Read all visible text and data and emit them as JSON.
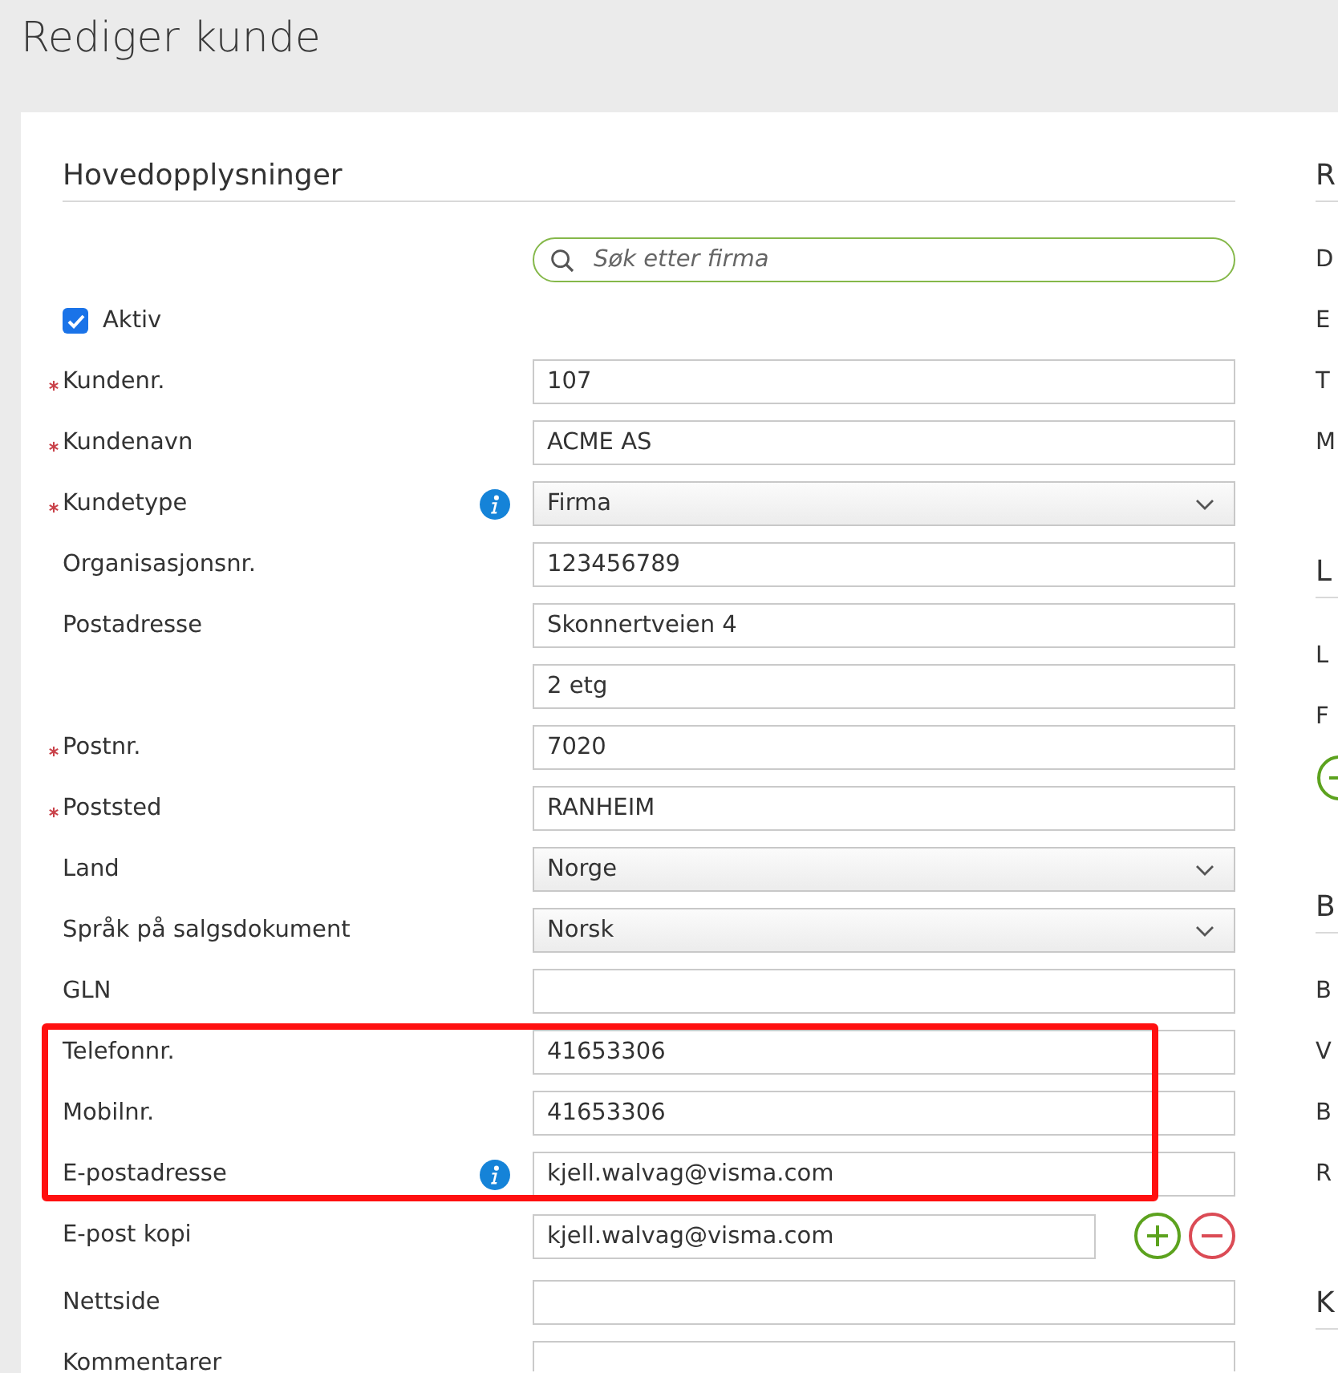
{
  "page": {
    "title": "Rediger kunde"
  },
  "main_section": {
    "heading": "Hovedopplysninger",
    "search": {
      "placeholder": "Søk etter firma"
    },
    "rows": [
      {
        "kind": "checkbox",
        "label": "Aktiv",
        "checked": true,
        "required": false,
        "info": false,
        "highlighted": false
      },
      {
        "kind": "text",
        "label": "Kundenr.",
        "value": "107",
        "required": true,
        "info": false,
        "highlighted": false
      },
      {
        "kind": "text",
        "label": "Kundenavn",
        "value": "ACME AS",
        "required": true,
        "info": false,
        "highlighted": false
      },
      {
        "kind": "select",
        "label": "Kundetype",
        "value": "Firma",
        "required": true,
        "info": true,
        "highlighted": false
      },
      {
        "kind": "text",
        "label": "Organisasjonsnr.",
        "value": "123456789",
        "required": false,
        "info": false,
        "highlighted": false
      },
      {
        "kind": "text",
        "label": "Postadresse",
        "value": "Skonnertveien 4",
        "required": false,
        "info": false,
        "highlighted": false
      },
      {
        "kind": "text",
        "value": "2 etg",
        "required": false,
        "info": false,
        "highlighted": false
      },
      {
        "kind": "text",
        "label": "Postnr.",
        "value": "7020",
        "required": true,
        "info": false,
        "highlighted": false
      },
      {
        "kind": "text",
        "label": "Poststed",
        "value": "RANHEIM",
        "required": true,
        "info": false,
        "highlighted": false
      },
      {
        "kind": "select",
        "label": "Land",
        "value": "Norge",
        "required": false,
        "info": false,
        "highlighted": false
      },
      {
        "kind": "select",
        "label": "Språk på salgsdokument",
        "value": "Norsk",
        "required": false,
        "info": false,
        "highlighted": false
      },
      {
        "kind": "text",
        "label": "GLN",
        "required": false,
        "info": false,
        "highlighted": false
      },
      {
        "kind": "text",
        "label": "Telefonnr.",
        "value": "41653306",
        "required": false,
        "info": false,
        "highlighted": true
      },
      {
        "kind": "text",
        "label": "Mobilnr.",
        "value": "41653306",
        "required": false,
        "info": false,
        "highlighted": true
      },
      {
        "kind": "text",
        "label": "E-postadresse",
        "value": "kjell.walvag@visma.com",
        "required": false,
        "info": true,
        "highlighted": true
      },
      {
        "kind": "multi",
        "label": "E-post kopi",
        "value": "kjell.walvag@visma.com",
        "required": false,
        "info": false,
        "highlighted": false
      },
      {
        "kind": "text",
        "label": "Nettside",
        "required": false,
        "info": false,
        "highlighted": false
      },
      {
        "kind": "textarea",
        "label": "Kommentarer",
        "required": false,
        "info": false,
        "highlighted": false
      }
    ]
  },
  "right_panel": {
    "sections": [
      {
        "heading": "R",
        "labels": [
          "D",
          "E",
          "T",
          "M"
        ],
        "add_button": false
      },
      {
        "heading": "L",
        "labels": [
          "L",
          "F"
        ],
        "add_button": true
      },
      {
        "heading": "B",
        "labels": [
          "B",
          "V",
          "B",
          "R"
        ],
        "add_button": false
      },
      {
        "heading": "K",
        "add_button": false
      }
    ]
  }
}
